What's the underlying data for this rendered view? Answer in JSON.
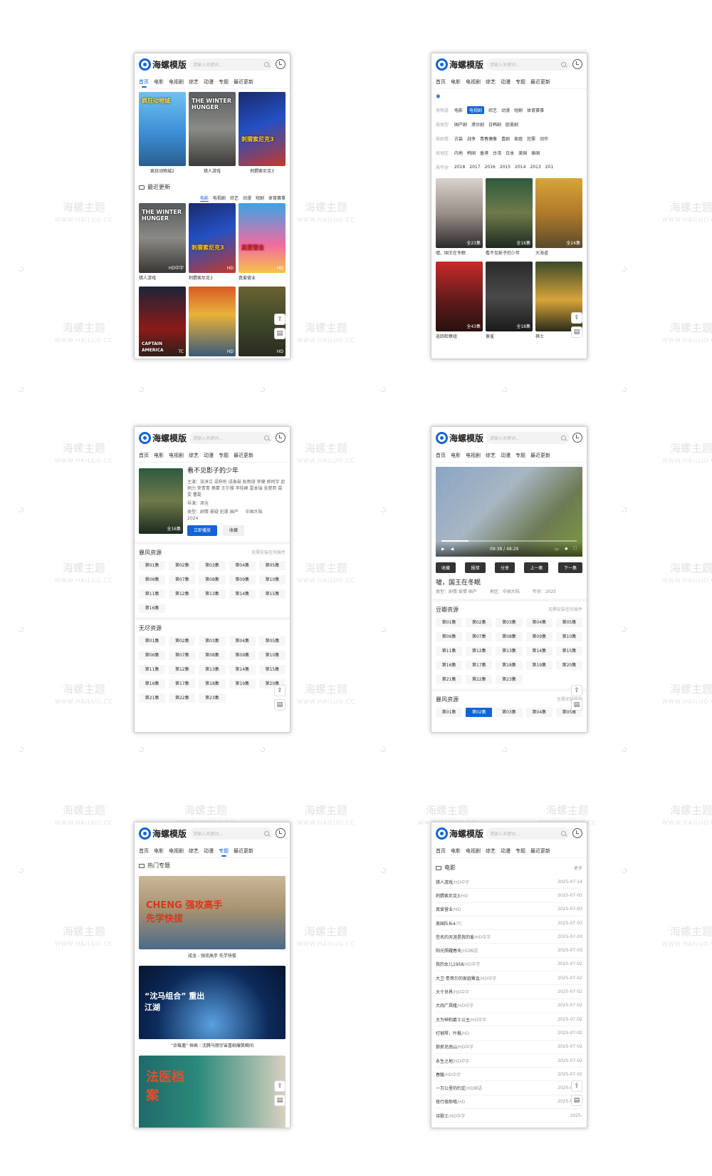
{
  "brand": {
    "logo_text": "海螺模版",
    "search_placeholder": "请输入关键词...",
    "accent": "#1264d6"
  },
  "watermark": {
    "title": "海螺主题",
    "url": "WWW.HAILUO.CC"
  },
  "nav": [
    "首页",
    "电影",
    "电视剧",
    "综艺",
    "动漫",
    "专题",
    "最近更新"
  ],
  "screen1": {
    "banner": [
      {
        "title": "疯狂动物城",
        "caption": "疯狂动物城2"
      },
      {
        "title": "THE WINTER HUNGER",
        "caption": "猎人游戏"
      },
      {
        "title": "刺猬索尼克3",
        "caption": "刺猬索尼克3"
      }
    ],
    "section": "最近更新",
    "subtabs": [
      "电影",
      "电视剧",
      "综艺",
      "动漫",
      "短剧",
      "体育赛事"
    ],
    "grid": [
      {
        "title": "THE WINTER HUNGER",
        "tag": "HD中字",
        "caption": "猎人游戏"
      },
      {
        "title": "刺猬索尼克3",
        "tag": "HD",
        "caption": "刺猬索尼克3"
      },
      {
        "title": "真爱营业",
        "tag": "HD",
        "caption": "真爱营业"
      },
      {
        "title": "CAPTAIN AMERICA",
        "tag": "TC",
        "caption": ""
      },
      {
        "title": "",
        "tag": "HD",
        "caption": ""
      },
      {
        "title": "",
        "tag": "HD",
        "caption": ""
      }
    ]
  },
  "screen2": {
    "filters": [
      {
        "label": "按频道",
        "items": [
          "电影",
          "电视剧",
          "综艺",
          "动漫",
          "短剧",
          "体育赛事"
        ],
        "active": "电视剧"
      },
      {
        "label": "按类型",
        "items": [
          "国产剧",
          "港台剧",
          "日韩剧",
          "欧美剧"
        ],
        "active": ""
      },
      {
        "label": "按剧情",
        "items": [
          "古装",
          "战争",
          "青春偶像",
          "喜剧",
          "家庭",
          "犯罪",
          "动作"
        ],
        "active": ""
      },
      {
        "label": "按地区",
        "items": [
          "内地",
          "韩国",
          "香港",
          "台湾",
          "日本",
          "美国",
          "泰国"
        ],
        "active": ""
      },
      {
        "label": "按年份",
        "items": [
          "2018",
          "2017",
          "2016",
          "2015",
          "2014",
          "2013",
          "201"
        ],
        "active": ""
      }
    ],
    "grid": [
      {
        "tag": "全23集",
        "caption": "嘘，国王在冬眠"
      },
      {
        "tag": "全16集",
        "caption": "看不见影子的少年"
      },
      {
        "tag": "全24集",
        "caption": "大海道"
      },
      {
        "tag": "全43集",
        "caption": "巡回检察组"
      },
      {
        "tag": "全18集",
        "caption": "黄雀"
      },
      {
        "tag": "",
        "caption": "棋士"
      }
    ]
  },
  "screen3": {
    "title": "看不见影子的少年",
    "cast": "主演：张淳文 梁梓彤 成泰燊 耿雨琦 李健 郭柯宇 赵炳力 荣青青 蔡蒙 王尔雅 李桂峰 雷本瑞 张楚熙 葛雯 曹磊",
    "director": "导演：周全",
    "genre": "类型：剧情 悬疑 犯罪 国产",
    "region": "中国大陆",
    "year": "2024",
    "poster_tag": "全16集",
    "play_btn": "立即播放",
    "fav_btn": "收藏",
    "sources": [
      {
        "name": "暴风资源",
        "note": "无需安装任何插件",
        "episodes": [
          "第01集",
          "第02集",
          "第03集",
          "第04集",
          "第05集",
          "第06集",
          "第07集",
          "第08集",
          "第09集",
          "第10集",
          "第11集",
          "第12集",
          "第13集",
          "第14集",
          "第15集",
          "第16集"
        ]
      },
      {
        "name": "无尽资源",
        "note": "",
        "episodes": [
          "第01集",
          "第02集",
          "第03集",
          "第04集",
          "第05集",
          "第06集",
          "第07集",
          "第08集",
          "第09集",
          "第10集",
          "第11集",
          "第12集",
          "第13集",
          "第14集",
          "第15集",
          "第16集",
          "第17集",
          "第18集",
          "第19集",
          "第20集",
          "第21集",
          "第22集",
          "第23集"
        ]
      }
    ]
  },
  "screen4": {
    "time": "09:38 / 48:29",
    "progress": 0.2,
    "buttons": [
      "收藏",
      "报错",
      "分享",
      "上一集",
      "下一集"
    ],
    "title": "嘘，国王在冬眠",
    "genre": "类型：剧情 爱情 国产",
    "region": "地区：中国大陆",
    "year": "年份：2025",
    "sources": [
      {
        "name": "豆瓣资源",
        "note": "无需安装任何插件",
        "episodes": [
          "第01集",
          "第02集",
          "第03集",
          "第04集",
          "第05集",
          "第06集",
          "第07集",
          "第08集",
          "第09集",
          "第10集",
          "第11集",
          "第12集",
          "第13集",
          "第14集",
          "第15集",
          "第16集",
          "第17集",
          "第18集",
          "第19集",
          "第20集",
          "第21集",
          "第22集",
          "第23集"
        ]
      },
      {
        "name": "暴风资源",
        "note": "无需安装任何",
        "episodes": [
          "第01集",
          "第02集",
          "第03集",
          "第04集",
          "第05集"
        ]
      }
    ]
  },
  "screen5": {
    "section": "热门专题",
    "topics": [
      {
        "art": "CHENG 强攻高手 先学快拔",
        "caption": "成龙 - 强攻高手 先学快拔"
      },
      {
        "art": "“沈马组合” 重出江湖",
        "caption": "“余莓邀”·恒高｜沈腾马丽宇宙喜剧爆笑瞬间"
      },
      {
        "art": "法医档案",
        "caption": ""
      }
    ]
  },
  "screen6": {
    "section": "电影",
    "more": "更多",
    "items": [
      {
        "name": "猎人游戏",
        "tag": "/HD中字",
        "date": "2025-07-14"
      },
      {
        "name": "刺猬索尼克3",
        "tag": "/HD",
        "date": "2025-07-03"
      },
      {
        "name": "真爱营业",
        "tag": "/HD",
        "date": "2025-07-03"
      },
      {
        "name": "美国队长4",
        "tag": "/TC",
        "date": "2025-07-03"
      },
      {
        "name": "签名的天涯是我的爱",
        "tag": "/HD中字",
        "date": "2025-07-03"
      },
      {
        "name": "阳光照耀春天",
        "tag": "/HD国语",
        "date": "2025-07-03"
      },
      {
        "name": "我的女儿1958",
        "tag": "/HD中字",
        "date": "2025-07-02"
      },
      {
        "name": "大卫·贵哥尔的家庭聚会",
        "tag": "/HD中字",
        "date": "2025-07-02"
      },
      {
        "name": "大千世界",
        "tag": "/HD中字",
        "date": "2025-07-02"
      },
      {
        "name": "大闹广昌隆",
        "tag": "/HD中字",
        "date": "2025-07-02"
      },
      {
        "name": "大为神和爵士公主",
        "tag": "/HD中字",
        "date": "2025-07-02"
      },
      {
        "name": "打钢琴，叶枫",
        "tag": "/HD",
        "date": "2025-07-02"
      },
      {
        "name": "狼抓兄南山",
        "tag": "/HD中字",
        "date": "2025-07-02"
      },
      {
        "name": "永生之地",
        "tag": "/HD中字",
        "date": "2025-07-02"
      },
      {
        "name": "春暖",
        "tag": "/HD中字",
        "date": "2025-07-02"
      },
      {
        "name": "一万公里的约定",
        "tag": "/HD国语",
        "date": "2025-07-02"
      },
      {
        "name": "夜行夜郎嗔",
        "tag": "/HD",
        "date": "2025-07-02"
      },
      {
        "name": "诗歌士",
        "tag": "/HD中字",
        "date": "2025-"
      }
    ]
  }
}
